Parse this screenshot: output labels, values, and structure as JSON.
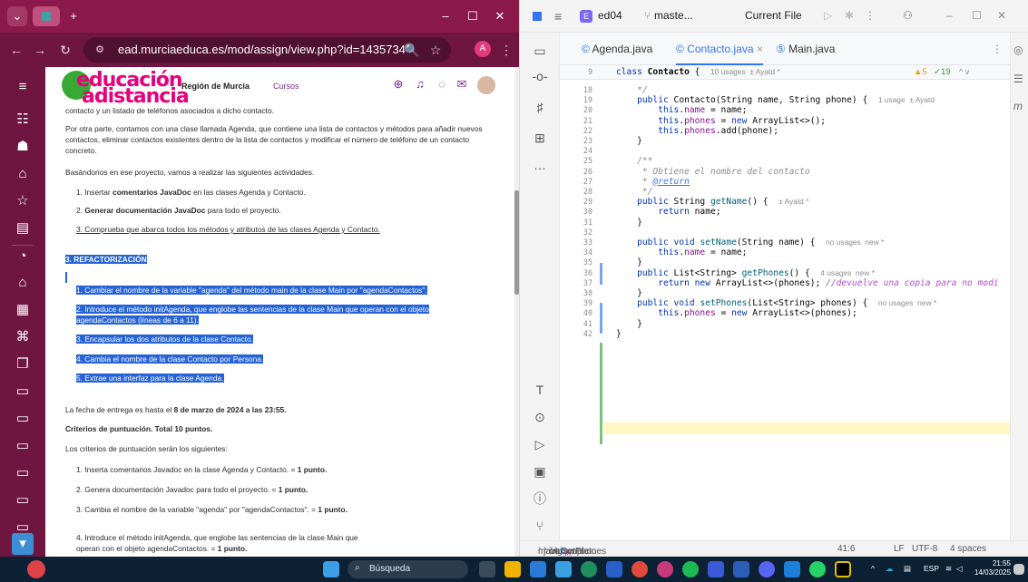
{
  "browser": {
    "tab_title": "",
    "url": "ead.murciaeducaca.es/mod/assign/view.php?id=1435734",
    "url_display": "ead.murciaeduca.es/mod/assign/view.php?id=1435734",
    "profile_letter": "A",
    "accent": "#8b1a4a"
  },
  "site": {
    "logo_top": "educación",
    "logo_bottom": "adistancia",
    "region_label": "Región de Murcia",
    "cursos_label": "Cursos"
  },
  "content": {
    "line1": "contacto y un listado de teléfonos asociados a dicho contacto.",
    "para1": "Por otra parte, contamos con una clase llamada Agenda, que contiene una lista de contactos y métodos para añadir nuevos contactos, eliminar contactos existentes dentro de la lista de contactos y  modificar el número de teléfono de un contacto concreto.",
    "para2": "Basándonos en ese proyecto, vamos a realizar las siguientes actividades.",
    "act1_pre": "1. Insertar ",
    "act1_bold": "comentarios JavaDoc",
    "act1_post": " en las clases Agenda y Contacto.",
    "act2_pre": "2. ",
    "act2_bold": "Generar documentación JavaDoc",
    "act2_post": " para todo el proyecto.",
    "act3": "3. Comprueba que abarca todos los métodos y atributos de las clases Agenda y Contacto.",
    "refact_heading": "3. REFACTORIZACIÓN",
    "refact_items": [
      "1. Cambiar el nombre de la variable \"agenda\" del método main de la clase Main por \"agendaContactos\".",
      "2. Introduce el método initAgenda, que englobe las sentencias de la clase Main que operan con el objeto agendaContactos (líneas de 6 a 11).",
      "3. Encapsular los dos atributos de la clase Contacto.",
      "4. Cambia el nombre de la clase Contacto por Persona.",
      "5. Extrae una interfaz para la clase Agenda."
    ],
    "due_pre": "La fecha de entrega es hasta el ",
    "due_bold": "8 de marzo de 2024  a las 23:55.",
    "criteria_heading": "Criterios de puntuación. Total 10 puntos.",
    "criteria_intro": "Los criterios de puntuación serán los siguientes:",
    "criteria": [
      {
        "text": "1. Inserta comentarios Javadoc en la clase Agenda y Contacto. = ",
        "pts": "1 punto."
      },
      {
        "text": "2. Genera documentación Javadoc para todo el proyecto. = ",
        "pts": "1 punto."
      },
      {
        "text": "3. Cambia el nombre de la variable \"agenda\" por \"agendaContactos\". = ",
        "pts": "1 punto."
      },
      {
        "text": "4. Introduce el método initAgenda, que englobe las sentencias de la clase Main que operan con el objeto agendaContactos. = ",
        "pts": "1 punto."
      }
    ]
  },
  "ide": {
    "project": "ed04",
    "branch": "maste...",
    "run_config": "Current File",
    "tabs": [
      "Agenda.java",
      "Contacto.java",
      "Main.java"
    ],
    "active_tab": "Contacto.java",
    "sticky_line_no": "9",
    "sticky_code": "class Contacto {",
    "sticky_hint": "10 usages  ± Ayatd *",
    "warnings": "5",
    "checks": "19",
    "lines": [
      {
        "n": "18",
        "code": "    */"
      },
      {
        "n": "19",
        "code": "    public Contacto(String name, String phone) {",
        "hint": "1 usage  ± Ayatd"
      },
      {
        "n": "20",
        "code": "        this.name = name;"
      },
      {
        "n": "21",
        "code": "        this.phones = new ArrayList<>();"
      },
      {
        "n": "22",
        "code": "        this.phones.add(phone);"
      },
      {
        "n": "23",
        "code": "    }"
      },
      {
        "n": "24",
        "code": ""
      },
      {
        "n": "25",
        "code": "    /**"
      },
      {
        "n": "26",
        "code": "     * Obtiene el nombre del contacto"
      },
      {
        "n": "27",
        "code": "     * @return"
      },
      {
        "n": "28",
        "code": "     */"
      },
      {
        "n": "29",
        "code": "    public String getName() {",
        "hint": "± Ayatd *"
      },
      {
        "n": "30",
        "code": "        return name;"
      },
      {
        "n": "31",
        "code": "    }"
      },
      {
        "n": "32",
        "code": ""
      },
      {
        "n": "33",
        "code": "    public void setName(String name) {",
        "hint": "no usages  new *"
      },
      {
        "n": "34",
        "code": "        this.name = name;"
      },
      {
        "n": "35",
        "code": "    }"
      },
      {
        "n": "36",
        "code": "    public List<String> getPhones() {",
        "hint": "4 usages  new *"
      },
      {
        "n": "37",
        "code": "        return new ArrayList<>(phones); //devuelve una copia para no modi"
      },
      {
        "n": "38",
        "code": "    }"
      },
      {
        "n": "39",
        "code": "    public void setPhones(List<String> phones) {",
        "hint": "no usages  new *"
      },
      {
        "n": "40",
        "code": "        this.phones = new ArrayList<>(phones);"
      },
      {
        "n": "41",
        "code": "    }"
      },
      {
        "n": "42",
        "code": "}"
      }
    ],
    "breadcrumb": [
      "main",
      "java",
      "org",
      "example",
      "Contacto",
      "setPhones"
    ],
    "status_right": [
      "41:6",
      "LF",
      "UTF-8",
      "4 spaces"
    ]
  },
  "taskbar": {
    "search_placeholder": "Búsqueda",
    "lang": "ESP",
    "time": "21:55",
    "date": "14/03/2025"
  }
}
